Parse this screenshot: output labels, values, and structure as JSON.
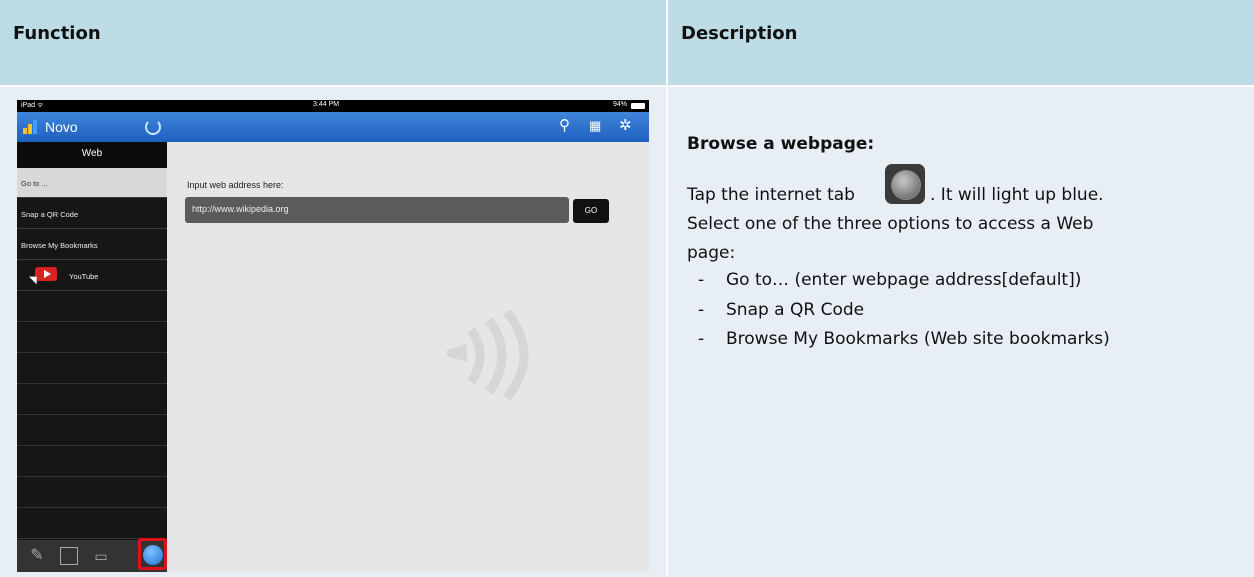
{
  "table": {
    "function_header": "Function",
    "description_header": "Description"
  },
  "ipad": {
    "status_left": "iPad ᯤ",
    "status_time": "3:44 PM",
    "status_battery": "94%",
    "app_title": "Novo",
    "sidebar_header": "Web",
    "sidebar_items": [
      "Go to ...",
      "Snap a QR Code",
      "Browse My Bookmarks",
      "YouTube"
    ],
    "selected_item": "Go to ...",
    "input_label": "Input web address here:",
    "url_value": "http://www.wikipedia.org",
    "go_label": "GO",
    "toolbar_icons": [
      "link-icon",
      "grid-icon",
      "gear-icon"
    ],
    "bottom_tabs": [
      "pencil-icon",
      "image-icon",
      "folder-icon",
      "globe-icon"
    ],
    "highlight_color": "#e0101a",
    "accent_color": "#2f74d0"
  },
  "description": {
    "heading": "Browse a webpage:",
    "line1_before": "Tap the internet tab",
    "line1_after": ". It will light up blue.",
    "line2": "Select one of the three options to access a Web",
    "line3": "page:",
    "bullets": [
      "Go to… (enter webpage address[default])",
      "Snap a QR Code",
      "Browse My Bookmarks (Web site bookmarks)"
    ]
  }
}
